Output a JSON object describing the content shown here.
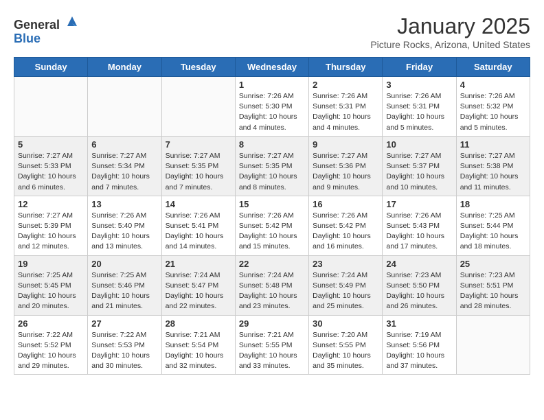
{
  "header": {
    "logo_general": "General",
    "logo_blue": "Blue",
    "title": "January 2025",
    "subtitle": "Picture Rocks, Arizona, United States"
  },
  "weekdays": [
    "Sunday",
    "Monday",
    "Tuesday",
    "Wednesday",
    "Thursday",
    "Friday",
    "Saturday"
  ],
  "weeks": [
    [
      {
        "day": "",
        "info": ""
      },
      {
        "day": "",
        "info": ""
      },
      {
        "day": "",
        "info": ""
      },
      {
        "day": "1",
        "info": "Sunrise: 7:26 AM\nSunset: 5:30 PM\nDaylight: 10 hours and 4 minutes."
      },
      {
        "day": "2",
        "info": "Sunrise: 7:26 AM\nSunset: 5:31 PM\nDaylight: 10 hours and 4 minutes."
      },
      {
        "day": "3",
        "info": "Sunrise: 7:26 AM\nSunset: 5:31 PM\nDaylight: 10 hours and 5 minutes."
      },
      {
        "day": "4",
        "info": "Sunrise: 7:26 AM\nSunset: 5:32 PM\nDaylight: 10 hours and 5 minutes."
      }
    ],
    [
      {
        "day": "5",
        "info": "Sunrise: 7:27 AM\nSunset: 5:33 PM\nDaylight: 10 hours and 6 minutes."
      },
      {
        "day": "6",
        "info": "Sunrise: 7:27 AM\nSunset: 5:34 PM\nDaylight: 10 hours and 7 minutes."
      },
      {
        "day": "7",
        "info": "Sunrise: 7:27 AM\nSunset: 5:35 PM\nDaylight: 10 hours and 7 minutes."
      },
      {
        "day": "8",
        "info": "Sunrise: 7:27 AM\nSunset: 5:35 PM\nDaylight: 10 hours and 8 minutes."
      },
      {
        "day": "9",
        "info": "Sunrise: 7:27 AM\nSunset: 5:36 PM\nDaylight: 10 hours and 9 minutes."
      },
      {
        "day": "10",
        "info": "Sunrise: 7:27 AM\nSunset: 5:37 PM\nDaylight: 10 hours and 10 minutes."
      },
      {
        "day": "11",
        "info": "Sunrise: 7:27 AM\nSunset: 5:38 PM\nDaylight: 10 hours and 11 minutes."
      }
    ],
    [
      {
        "day": "12",
        "info": "Sunrise: 7:27 AM\nSunset: 5:39 PM\nDaylight: 10 hours and 12 minutes."
      },
      {
        "day": "13",
        "info": "Sunrise: 7:26 AM\nSunset: 5:40 PM\nDaylight: 10 hours and 13 minutes."
      },
      {
        "day": "14",
        "info": "Sunrise: 7:26 AM\nSunset: 5:41 PM\nDaylight: 10 hours and 14 minutes."
      },
      {
        "day": "15",
        "info": "Sunrise: 7:26 AM\nSunset: 5:42 PM\nDaylight: 10 hours and 15 minutes."
      },
      {
        "day": "16",
        "info": "Sunrise: 7:26 AM\nSunset: 5:42 PM\nDaylight: 10 hours and 16 minutes."
      },
      {
        "day": "17",
        "info": "Sunrise: 7:26 AM\nSunset: 5:43 PM\nDaylight: 10 hours and 17 minutes."
      },
      {
        "day": "18",
        "info": "Sunrise: 7:25 AM\nSunset: 5:44 PM\nDaylight: 10 hours and 18 minutes."
      }
    ],
    [
      {
        "day": "19",
        "info": "Sunrise: 7:25 AM\nSunset: 5:45 PM\nDaylight: 10 hours and 20 minutes."
      },
      {
        "day": "20",
        "info": "Sunrise: 7:25 AM\nSunset: 5:46 PM\nDaylight: 10 hours and 21 minutes."
      },
      {
        "day": "21",
        "info": "Sunrise: 7:24 AM\nSunset: 5:47 PM\nDaylight: 10 hours and 22 minutes."
      },
      {
        "day": "22",
        "info": "Sunrise: 7:24 AM\nSunset: 5:48 PM\nDaylight: 10 hours and 23 minutes."
      },
      {
        "day": "23",
        "info": "Sunrise: 7:24 AM\nSunset: 5:49 PM\nDaylight: 10 hours and 25 minutes."
      },
      {
        "day": "24",
        "info": "Sunrise: 7:23 AM\nSunset: 5:50 PM\nDaylight: 10 hours and 26 minutes."
      },
      {
        "day": "25",
        "info": "Sunrise: 7:23 AM\nSunset: 5:51 PM\nDaylight: 10 hours and 28 minutes."
      }
    ],
    [
      {
        "day": "26",
        "info": "Sunrise: 7:22 AM\nSunset: 5:52 PM\nDaylight: 10 hours and 29 minutes."
      },
      {
        "day": "27",
        "info": "Sunrise: 7:22 AM\nSunset: 5:53 PM\nDaylight: 10 hours and 30 minutes."
      },
      {
        "day": "28",
        "info": "Sunrise: 7:21 AM\nSunset: 5:54 PM\nDaylight: 10 hours and 32 minutes."
      },
      {
        "day": "29",
        "info": "Sunrise: 7:21 AM\nSunset: 5:55 PM\nDaylight: 10 hours and 33 minutes."
      },
      {
        "day": "30",
        "info": "Sunrise: 7:20 AM\nSunset: 5:55 PM\nDaylight: 10 hours and 35 minutes."
      },
      {
        "day": "31",
        "info": "Sunrise: 7:19 AM\nSunset: 5:56 PM\nDaylight: 10 hours and 37 minutes."
      },
      {
        "day": "",
        "info": ""
      }
    ]
  ]
}
